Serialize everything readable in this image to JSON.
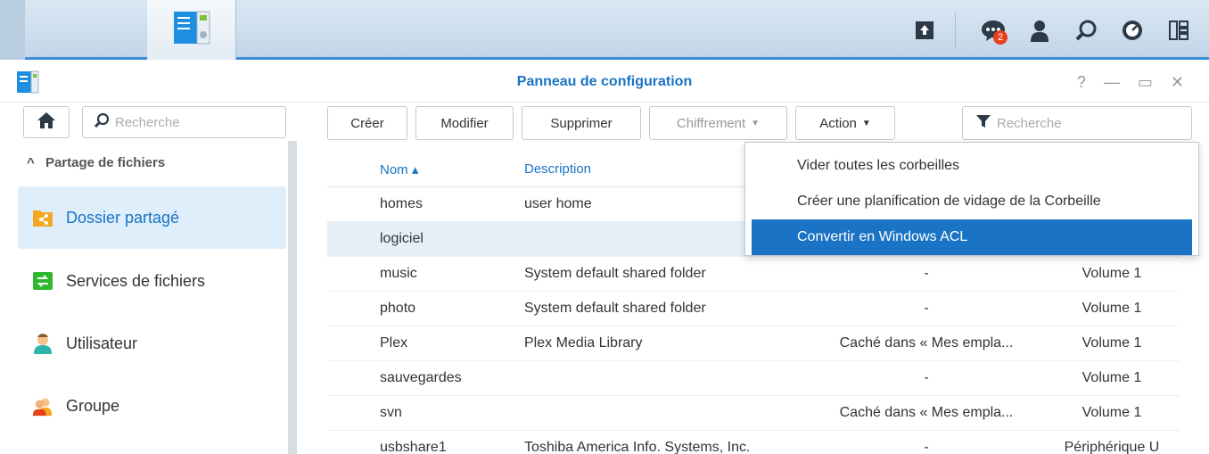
{
  "taskbar": {
    "notification_count": "2",
    "icons": [
      "apps-grid-icon",
      "control-panel-icon",
      "upload-icon",
      "chat-notification-icon",
      "user-icon",
      "search-icon",
      "dashboard-icon",
      "widgets-icon"
    ]
  },
  "window": {
    "title": "Panneau de configuration",
    "controls": {
      "help": "?",
      "minimize": "—",
      "restore": "▭",
      "close": "✕"
    }
  },
  "sidebar": {
    "search_placeholder": "Recherche",
    "section": "Partage de fichiers",
    "items": [
      {
        "label": "Dossier partagé",
        "icon": "shared-folder-icon",
        "active": true
      },
      {
        "label": "Services de fichiers",
        "icon": "file-services-icon"
      },
      {
        "label": "Utilisateur",
        "icon": "user-icon"
      },
      {
        "label": "Groupe",
        "icon": "group-icon"
      }
    ]
  },
  "toolbar": {
    "create": "Créer",
    "modify": "Modifier",
    "delete": "Supprimer",
    "encryption": "Chiffrement",
    "action": "Action",
    "search_placeholder": "Recherche"
  },
  "table": {
    "columns": {
      "name": "Nom ▴",
      "description": "Description"
    },
    "rows": [
      {
        "name": "homes",
        "description": "user home",
        "hidden": "",
        "volume": ""
      },
      {
        "name": "logiciel",
        "description": "",
        "hidden": "",
        "volume": ""
      },
      {
        "name": "music",
        "description": "System default shared folder",
        "hidden": "-",
        "volume": "Volume 1"
      },
      {
        "name": "photo",
        "description": "System default shared folder",
        "hidden": "-",
        "volume": "Volume 1"
      },
      {
        "name": "Plex",
        "description": "Plex Media Library",
        "hidden": "Caché dans « Mes empla...",
        "volume": "Volume 1"
      },
      {
        "name": "sauvegardes",
        "description": "",
        "hidden": "-",
        "volume": "Volume 1"
      },
      {
        "name": "svn",
        "description": "",
        "hidden": "Caché dans « Mes empla...",
        "volume": "Volume 1"
      },
      {
        "name": "usbshare1",
        "description": "Toshiba America Info. Systems, Inc.",
        "hidden": "-",
        "volume": "Périphérique U"
      }
    ]
  },
  "action_menu": {
    "items": [
      "Vider toutes les corbeilles",
      "Créer une planification de vidage de la Corbeille",
      "Convertir en Windows ACL"
    ]
  },
  "colors": {
    "accent": "#1a73c4",
    "selection": "#e6f0f9",
    "highlight": "#1a73c4"
  }
}
